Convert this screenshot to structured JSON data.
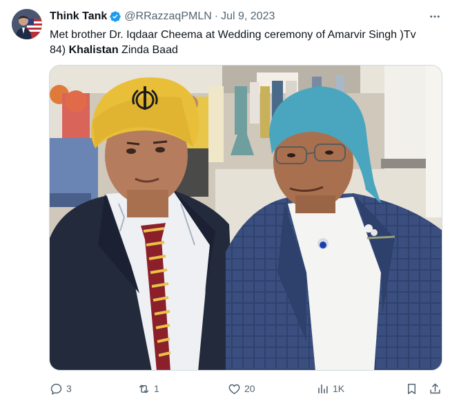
{
  "tweet": {
    "author_name": "Think Tank",
    "author_handle": "@RRazzaqPMLN",
    "separator": "·",
    "date": "Jul 9, 2023",
    "text_line1": "Met brother Dr. Iqdaar Cheema at Wedding ceremony of Amarvir Singh )Tv",
    "text_line2_prefix": "84) ",
    "text_line2_bold": "Khalistan",
    "text_line2_suffix": " Zinda Baad"
  },
  "actions": {
    "replies": "3",
    "reposts": "1",
    "likes": "20",
    "views": "1K"
  },
  "icons": {
    "verified": "verified-badge-icon",
    "more": "more-icon",
    "reply": "reply-icon",
    "repost": "repost-icon",
    "like": "heart-icon",
    "views": "views-icon",
    "bookmark": "bookmark-icon",
    "share": "share-icon"
  },
  "colors": {
    "verified_blue": "#1d9bf0",
    "secondary_text": "#536471",
    "primary_text": "#0f1419"
  }
}
